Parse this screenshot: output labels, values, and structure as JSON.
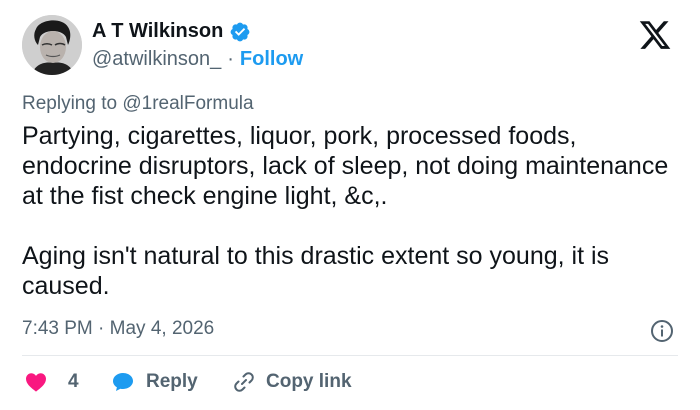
{
  "author": {
    "name": "A T Wilkinson",
    "handle": "@atwilkinson_",
    "separator": "·",
    "follow_label": "Follow"
  },
  "colors": {
    "accent": "#1d9bf0",
    "like": "#f91880",
    "text": "#0f1419",
    "muted": "#536471"
  },
  "icons": {
    "verified": "verified-badge-icon",
    "logo": "x-logo-icon",
    "info": "info-icon",
    "like": "heart-icon",
    "reply": "speech-bubble-icon",
    "copy": "link-icon"
  },
  "tweet": {
    "replying_to": "Replying to @1realFormula",
    "paragraph_1": "Partying, cigarettes, liquor, pork, processed foods, endocrine disruptors, lack of sleep, not doing maintenance at the fist check engine light, &c,.",
    "paragraph_2": "Aging isn't natural to this drastic extent so young, it is caused.",
    "timestamp": "7:43 PM · May 4, 2026"
  },
  "actions": {
    "like_count": "4",
    "reply_label": "Reply",
    "copy_label": "Copy link"
  }
}
